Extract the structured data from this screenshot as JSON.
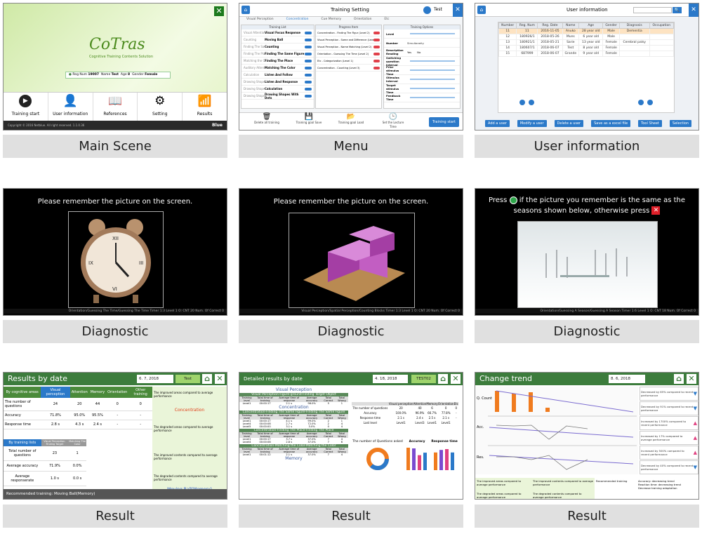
{
  "captions": [
    "Main Scene",
    "Menu",
    "User information",
    "Diagnostic",
    "Diagnostic",
    "Diagnostic",
    "Result",
    "Result",
    "Result"
  ],
  "main_scene": {
    "logo": "CoTras",
    "subtitle": "Cognitive Training Contents Solution",
    "reg_num_label": "Reg Num",
    "reg_num": "19007",
    "name_label": "Name",
    "name": "Test",
    "age_label": "Age",
    "age": "8",
    "gender_label": "Gender",
    "gender": "Female",
    "buttons": [
      "Training start",
      "User information",
      "References",
      "Setting",
      "Results"
    ],
    "footer": "Copyright © 2016 Netblue. All right reserved.  1.1.0.36",
    "brand": "Blue"
  },
  "menu": {
    "title": "Training Setting",
    "user": "Test",
    "tabs": [
      "Visual Perception",
      "Concentration",
      "Cue Memory",
      "Orientation",
      "Etc"
    ],
    "col_training_list": "Training List",
    "col_progress": "Progress Item",
    "col_options": "Training Options",
    "categories": [
      "Visual Attention",
      "Counting",
      "Finding The Same Figure",
      "Finding The Place",
      "Matching the Color",
      "Auditory Attention",
      "Calculation",
      "Drawing Shapes With Dots"
    ],
    "items": [
      "Visual Focus Response",
      "Moving Ball",
      "Counting",
      "Finding The Same Figure",
      "Finding The Place",
      "Matching The Color",
      "Listen And Follow",
      "Listen And Response",
      "Calculation",
      "Drawing Shapes With Dots"
    ],
    "progress": [
      "Concentration - Finding The Figur (Level 2)",
      "Visual Perception - Same and Difference (Level 2)",
      "Visual Perception - Name Matching (Level 2)",
      "Orientation - Guessing The Time (Level 2)",
      "Etc - Categorization (Level 1)",
      "Concentration - Counting (Level 3)"
    ],
    "options": [
      "Level",
      "Number",
      "Description Reading",
      "Switching question interval",
      "Prior stimulus Time",
      "Stimulus Interval",
      "Target stimulus Time",
      "Feedback Time"
    ],
    "simultaneity": "Simultaneity",
    "yes": "Yes",
    "no": "No",
    "bottom": [
      "Delete all training",
      "Training goal Save",
      "Training goal Load",
      "Set the Lecture Time"
    ],
    "start": "Training start"
  },
  "user_info": {
    "title": "User information",
    "headers": [
      "Number",
      "Reg. Num",
      "Reg. Date",
      "Name",
      "Age",
      "Gender",
      "Diagnosis",
      "Occupation"
    ],
    "rows": [
      [
        "11",
        "11",
        "2016-11-05",
        "Anuko",
        "28 year old",
        "Male",
        "Dementia",
        ""
      ],
      [
        "12",
        "180926/1",
        "2018-05-26",
        "Muns",
        "6 year old",
        "Male",
        "",
        ""
      ],
      [
        "13",
        "180921/1",
        "2018-05-21",
        "Sarie",
        "13 year old",
        "Female",
        "Cerebral palsy",
        ""
      ],
      [
        "14",
        "180607/1",
        "2018-06-07",
        "Test",
        "8 year old",
        "Female",
        "",
        ""
      ],
      [
        "15",
        "687999",
        "2018-06-07",
        "Grande",
        "9 year old",
        "Female",
        "",
        ""
      ]
    ],
    "buttons": [
      "Add a user",
      "Modify a user",
      "Delete a user",
      "Save as a excel file",
      "Tool Sheet",
      "Selection"
    ]
  },
  "diag1": {
    "instruction": "Please remember the picture on the screen.",
    "footer": "Orientation/Guessing The Time/Guessing The Time  Timer 1:3  Level 1  O: CNT 20  Num. Of Correct 0"
  },
  "diag2": {
    "instruction": "Please remember the picture on the screen.",
    "footer": "Visual Perception/Spatial Perception/Counting Blocks  Timer 1:3  Level 1  O: CNT 20  Num. Of Correct 0"
  },
  "diag3": {
    "line1_a": "Press",
    "line1_b": "if the picture you remember is the same as the",
    "line2_a": "seasons shown below, otherwise press",
    "footer": "Orientation/Guessing A Season/Guessing A Season  Timer 1:6  Level 1  O: CNT 18  Num. Of Correct 0"
  },
  "result1": {
    "title": "Results by date",
    "date": "6. 7, 2018",
    "user": "Test",
    "col_headers": [
      "By cognitive areas",
      "Visual perception",
      "Attention",
      "Memory",
      "Orientation",
      "Other training"
    ],
    "rows": [
      [
        "The number of questions",
        "24",
        "20",
        "44",
        "0",
        "0"
      ],
      [
        "Accuracy",
        "71.8%",
        "95.0%",
        "95.5%",
        "-",
        "-"
      ],
      [
        "Response time",
        "2.8 s",
        "4.3 s",
        "2.4 s",
        "-",
        "-"
      ]
    ],
    "by_training": "By training lists",
    "sub_headers": [
      "Visual Perception-Finding Target",
      "Matching The Color"
    ],
    "rows2": [
      [
        "Total number of questions",
        "23",
        "1"
      ],
      [
        "Average accuracy",
        "71.9%",
        "0.0%"
      ],
      [
        "Average responserate",
        "1.0 s",
        "0.0 s"
      ]
    ],
    "improved": "The improved areas compared to average performance",
    "improved_val": "Concentration",
    "degraded": "The degraded areas compared to average performance",
    "improved2": "The improved contents compared to average performance",
    "degraded2": "The degraded contents compared to average performance",
    "degraded2_val": "Moving Ball(Memory)",
    "recommended": "Recommended training",
    "recommended_val": "Moving Ball(Memory)"
  },
  "result2": {
    "title": "Detailed results by date",
    "date": "4. 18, 2018",
    "user": "TEST02",
    "sections": [
      "Visual Perception",
      "Visual Perception-Figure-ground-Finding Target Object",
      "Concentration",
      "Concentration-Finding The Same Figure-Finding The Same Figure",
      "Concentration-Finding The Place-Finding The Place",
      "Concentration-Matching the Color-Matching the Color",
      "Memory"
    ],
    "t_headers": [
      "Training level",
      "Total time of training",
      "Average time of response",
      "Average accuracy",
      "Total Correct",
      "Total Wrong"
    ],
    "rows_a": [
      [
        "Level1",
        "00:00:17",
        "2.1 s",
        "98.0%",
        "5",
        "1"
      ]
    ],
    "rows_b": [
      [
        "Level1",
        "00:00:17",
        "4.1 s",
        "99.0%",
        "2",
        "1"
      ],
      [
        "Level4",
        "00:00:08",
        "2.7 s",
        "72.0%",
        "2",
        "4"
      ],
      [
        "Level5",
        "00:00:00",
        "3.1 s",
        "3.0%",
        "0",
        "4"
      ]
    ],
    "rows_c": [
      [
        "Level1",
        "00:00:17",
        "3.7 s",
        "37.0%",
        "7",
        "4"
      ],
      [
        "Level4",
        "00:00:08",
        "2.8 s",
        "37.0%",
        "7",
        "6"
      ]
    ],
    "rows_d": [
      [
        "Level1",
        "00:01:12",
        "2.1 s",
        "37.0%",
        "7",
        "4"
      ]
    ],
    "summary_headers": [
      "",
      "Visual perception",
      "Attention",
      "Memory",
      "Orientation",
      "Etc"
    ],
    "summary_rows": [
      [
        "The number of questions",
        "20",
        "40",
        "6",
        "0",
        "0"
      ],
      [
        "Accuracy",
        "100.0%",
        "96.9%",
        "66.7%",
        "77.8%",
        "-"
      ],
      [
        "Response time",
        "2.1 s",
        "2.4 s",
        "2.5 s",
        "2.1 s",
        "-"
      ],
      [
        "Last level",
        "Level1",
        "Level3",
        "Level1",
        "Level1",
        ""
      ]
    ],
    "chart_titles": [
      "The number of Questions asked",
      "Accuracy",
      "Response time"
    ]
  },
  "result3": {
    "title": "Change trend",
    "date": "8. 6, 2018",
    "user": "Test",
    "row_labels": [
      "Q. Count",
      "Acc.",
      "Res."
    ],
    "notes": [
      "Decreased by 65% compared to recent performance",
      "Decreased by 91% compared to recent performance",
      "Increased by 1700% compared to recent performance",
      "Increased by 17% compared to average performance",
      "Increased by 500% compared to recent performance",
      "Decreased by 40% compared to recent performance"
    ],
    "improved_areas": "The improved areas compared to average performance",
    "degraded_areas": "The degraded areas compared to average performance",
    "improved_contents": "The improved contents compared to average performance",
    "degraded_contents": "The degraded contents compared to average performance",
    "recommended": "Recommended training",
    "recommended_list": [
      "Accuracy: decreasing trend",
      "Reaction time: decreasing trend",
      "Decrease training adaptation"
    ]
  },
  "colors": {
    "green": "#3c7c3c",
    "blue": "#2b79c9",
    "orange": "#f07b1e",
    "caption_bg": "#e0e0e0"
  }
}
